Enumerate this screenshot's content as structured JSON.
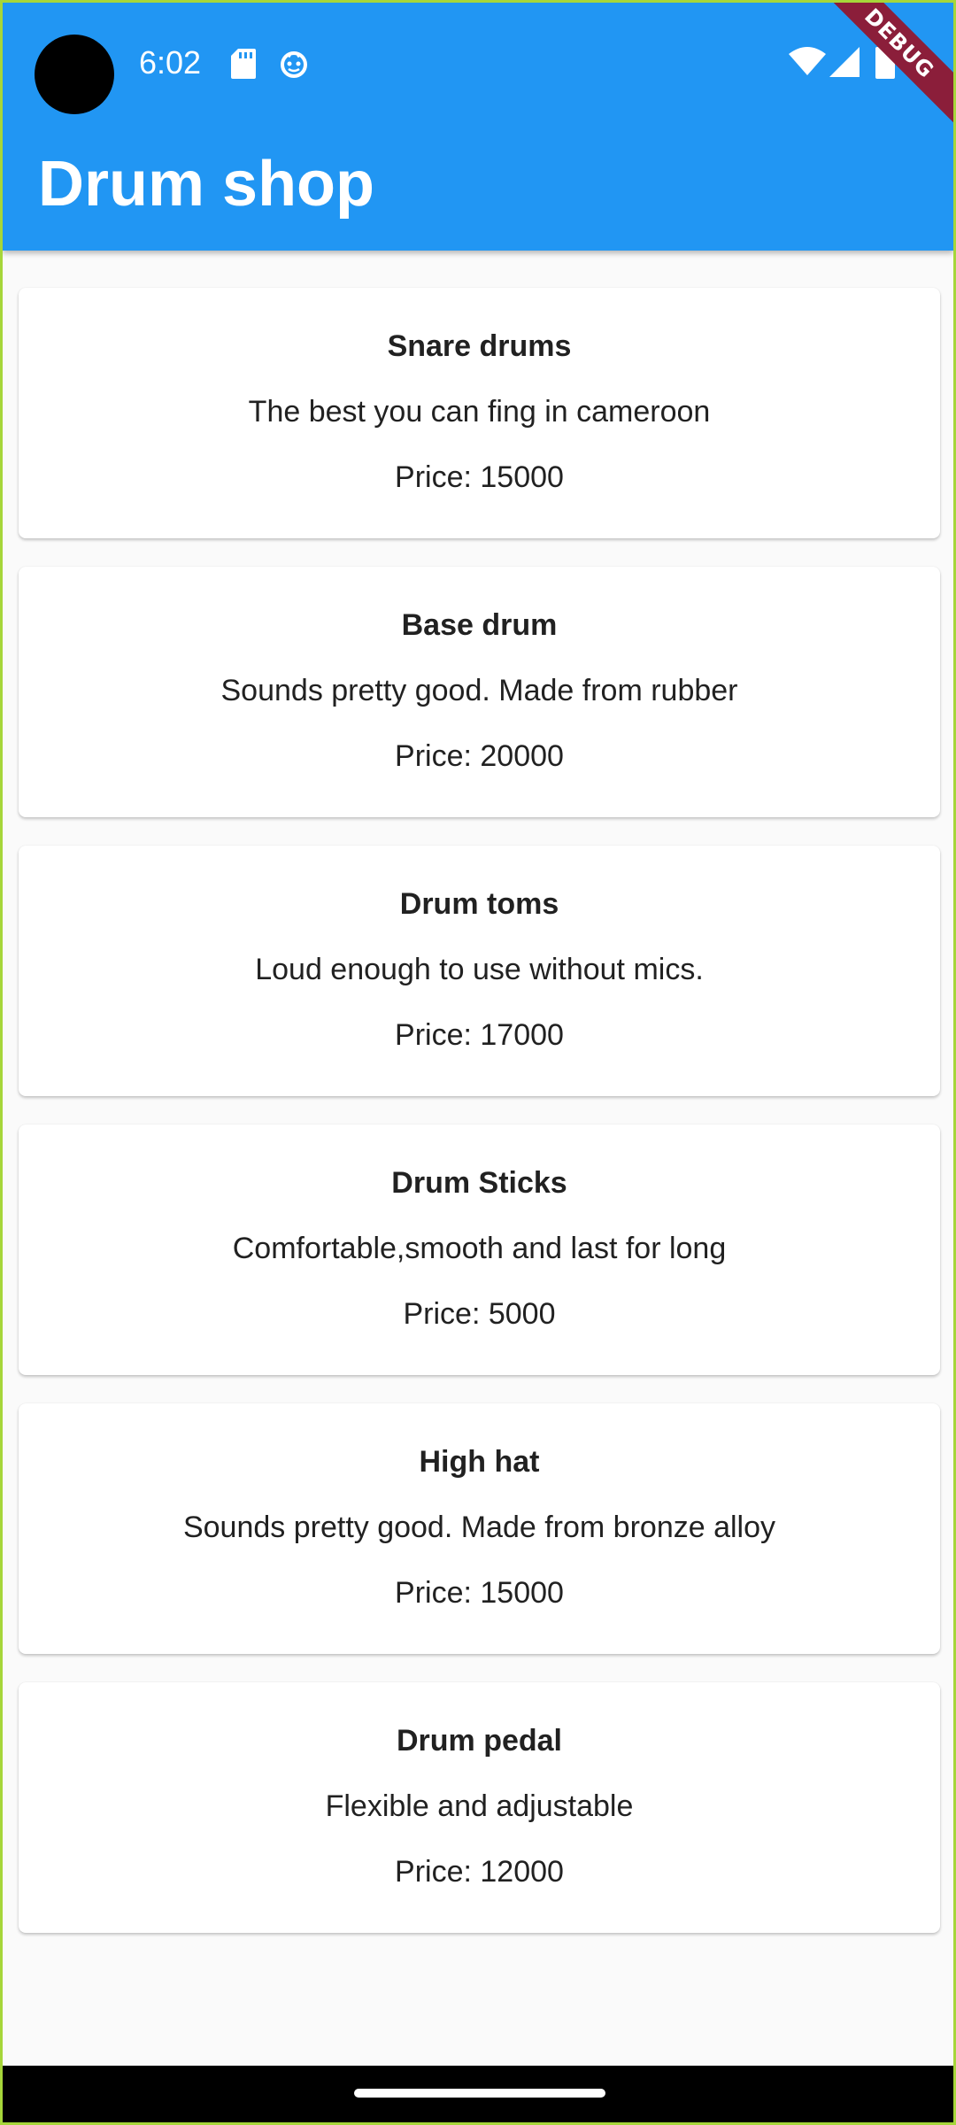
{
  "status_bar": {
    "time": "6:02",
    "icons": [
      "sd-card-icon",
      "debug-bug-icon",
      "wifi-icon",
      "cell-signal-icon",
      "battery-icon"
    ]
  },
  "debug_banner": "DEBUG",
  "app_bar": {
    "title": "Drum shop",
    "color": "#2196f3"
  },
  "products": [
    {
      "title": "Snare drums",
      "description": "The best you can fing in cameroon",
      "price": "Price: 15000"
    },
    {
      "title": "Base drum",
      "description": "Sounds pretty good. Made from rubber",
      "price": "Price: 20000"
    },
    {
      "title": "Drum toms",
      "description": "Loud enough to use without mics.",
      "price": "Price: 17000"
    },
    {
      "title": "Drum Sticks",
      "description": "Comfortable,smooth and last for long",
      "price": "Price: 5000"
    },
    {
      "title": "High hat",
      "description": "Sounds pretty good. Made from bronze alloy",
      "price": "Price: 15000"
    },
    {
      "title": "Drum pedal",
      "description": "Flexible and adjustable",
      "price": "Price: 12000"
    }
  ]
}
